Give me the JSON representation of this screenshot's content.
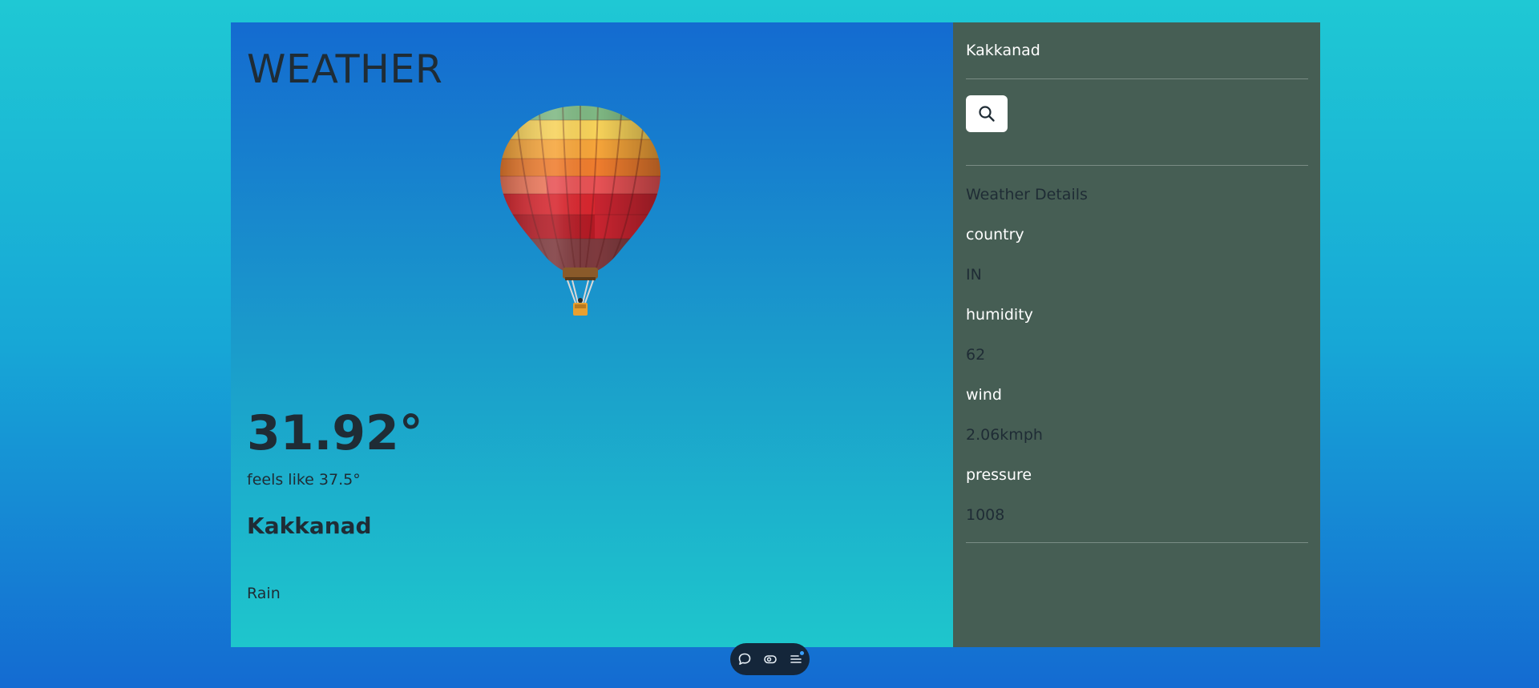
{
  "app": {
    "title": "WEATHER"
  },
  "current": {
    "temperature": "31.92°",
    "feels_like": "feels like 37.5°",
    "city": "Kakkanad",
    "condition": "Rain"
  },
  "sidebar": {
    "location": "Kakkanad",
    "details_title": "Weather Details",
    "details": [
      {
        "label": "country",
        "value": "IN"
      },
      {
        "label": "humidity",
        "value": "62"
      },
      {
        "label": "wind",
        "value": "2.06kmph"
      },
      {
        "label": "pressure",
        "value": "1008"
      }
    ]
  },
  "icons": {
    "search": "search-icon",
    "chat": "chat-icon",
    "eye": "eye-icon",
    "menu": "menu-icon"
  },
  "colors": {
    "sidebar_bg": "#465e54",
    "text_dark": "#1f2c35",
    "accent_dot": "#3aa0ff"
  }
}
